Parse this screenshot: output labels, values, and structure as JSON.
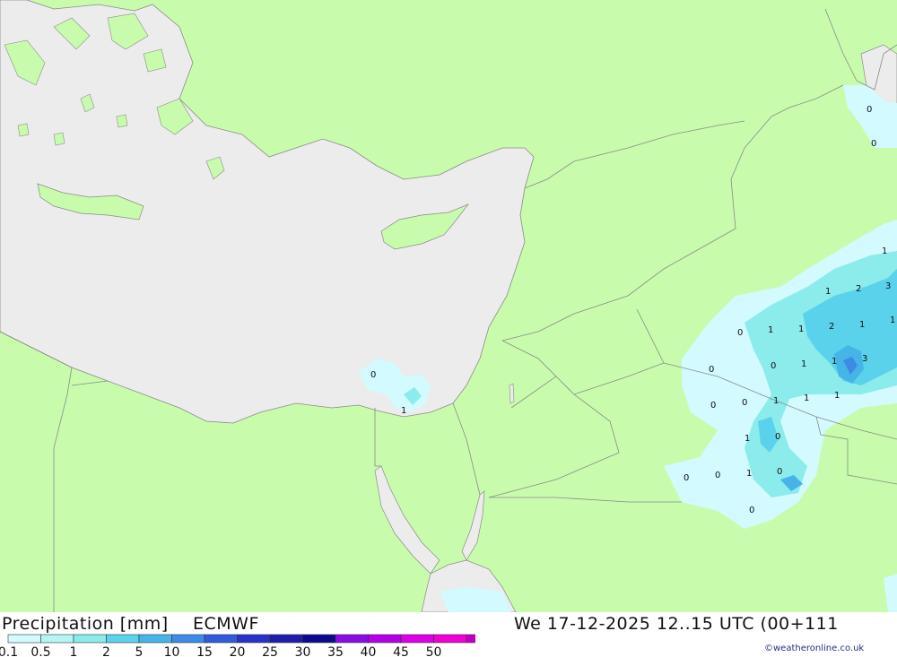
{
  "footer": {
    "title": "Precipitation [mm]",
    "model": "ECMWF",
    "valid_time": "We 17-12-2025 12..15 UTC (00+111",
    "credit": "©weatheronline.co.uk"
  },
  "legend": {
    "ticks": [
      "0.1",
      "0.5",
      "1",
      "2",
      "5",
      "10",
      "15",
      "20",
      "25",
      "30",
      "35",
      "40",
      "45",
      "50"
    ],
    "colors": [
      "#d2faff",
      "#b4f5f5",
      "#8cebeb",
      "#5ad2eb",
      "#46b4e6",
      "#3c8ce6",
      "#325adc",
      "#2832c8",
      "#1e1eaa",
      "#0a0a8c",
      "#8c0ae6",
      "#b400e6",
      "#dc00e6",
      "#f000d2",
      "#be00be"
    ]
  },
  "colors": {
    "land": "#c8fcac",
    "sea": "#ececec",
    "border": "#8a8a8a"
  },
  "map_labels": [
    {
      "id": "east-0a",
      "text": "0"
    },
    {
      "id": "east-0b",
      "text": "0"
    },
    {
      "id": "iraq-1a",
      "text": "1"
    },
    {
      "id": "iraq-1b",
      "text": "1"
    },
    {
      "id": "iraq-2",
      "text": "2"
    },
    {
      "id": "iraq-3a",
      "text": "3"
    },
    {
      "id": "iraq-0",
      "text": "0"
    },
    {
      "id": "iraq-1c",
      "text": "1"
    },
    {
      "id": "iraq-1d",
      "text": "1"
    },
    {
      "id": "iraq-2b",
      "text": "2"
    },
    {
      "id": "iraq-1e",
      "text": "1"
    },
    {
      "id": "iraq-1f",
      "text": "1"
    },
    {
      "id": "iraq-0b",
      "text": "0"
    },
    {
      "id": "iraq-0c",
      "text": "0"
    },
    {
      "id": "iraq-1g",
      "text": "1"
    },
    {
      "id": "iraq-1h",
      "text": "1"
    },
    {
      "id": "iraq-3b",
      "text": "3"
    },
    {
      "id": "sa-0a",
      "text": "0"
    },
    {
      "id": "sa-0b",
      "text": "0"
    },
    {
      "id": "sa-1a",
      "text": "1"
    },
    {
      "id": "sa-1b",
      "text": "1"
    },
    {
      "id": "sa-1c",
      "text": "1"
    },
    {
      "id": "sa-1d",
      "text": "1"
    },
    {
      "id": "sa-0c",
      "text": "0"
    },
    {
      "id": "sa-0d",
      "text": "0"
    },
    {
      "id": "sa-0e",
      "text": "0"
    },
    {
      "id": "sa-1e",
      "text": "1"
    },
    {
      "id": "sa-0f",
      "text": "0"
    },
    {
      "id": "egypt-0a",
      "text": "0"
    },
    {
      "id": "egypt-0b",
      "text": "0"
    },
    {
      "id": "redsea-1",
      "text": "1"
    }
  ]
}
